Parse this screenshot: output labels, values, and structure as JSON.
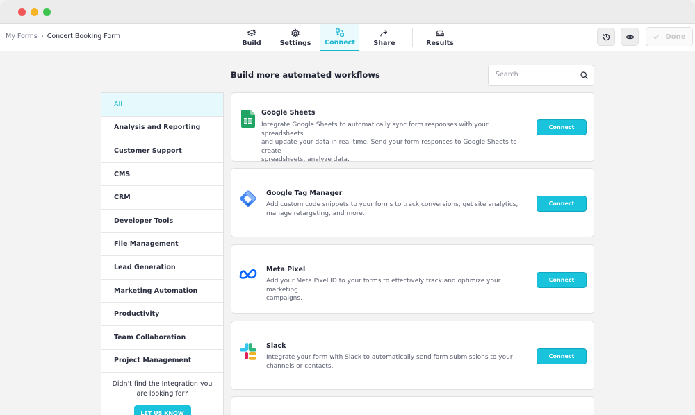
{
  "breadcrumb": {
    "root": "My Forms",
    "separator": "›",
    "current": "Concert Booking Form"
  },
  "nav": {
    "build": "Build",
    "settings": "Settings",
    "connect": "Connect",
    "share": "Share",
    "results": "Results",
    "active": "Connect"
  },
  "toolbar": {
    "done_label": "Done"
  },
  "main": {
    "title": "Build more automated workflows",
    "search_placeholder": "Search"
  },
  "categories": [
    "All",
    "Analysis and Reporting",
    "Customer Support",
    "CMS",
    "CRM",
    "Developer Tools",
    "File Management",
    "Lead Generation",
    "Marketing Automation",
    "Productivity",
    "Team Collaboration",
    "Project Management"
  ],
  "sidebar_footer": {
    "line1": "Didn't find the Integration you",
    "line2": "are looking for?",
    "button": "LET US KNOW"
  },
  "integrations": [
    {
      "name": "Google Sheets",
      "icon": "google-sheets-icon",
      "line1": "Integrate Google Sheets to automatically sync form responses with your spreadsheets",
      "line2": "and update your data in real time. Send your form responses to Google Sheets to create",
      "line3": "spreadsheets, analyze data.",
      "button": "Connect"
    },
    {
      "name": "Google Tag Manager",
      "icon": "google-tag-manager-icon",
      "line1": "Add custom code snippets to your forms to track conversions, get site analytics,",
      "line2": "manage retargeting, and more.",
      "button": "Connect"
    },
    {
      "name": "Meta Pixel",
      "icon": "meta-pixel-icon",
      "line1": "Add your Meta Pixel ID to your forms to effectively track and optimize your marketing",
      "line2": "campaigns.",
      "button": "Connect"
    },
    {
      "name": "Slack",
      "icon": "slack-icon",
      "line1": "Integrate your form with Slack to automatically send form submissions to your",
      "line2": "channels or contacts.",
      "button": "Connect"
    }
  ],
  "colors": {
    "accent": "#19c3db",
    "accent_dark": "#19b6cf",
    "active_bg": "#e6fafd"
  }
}
